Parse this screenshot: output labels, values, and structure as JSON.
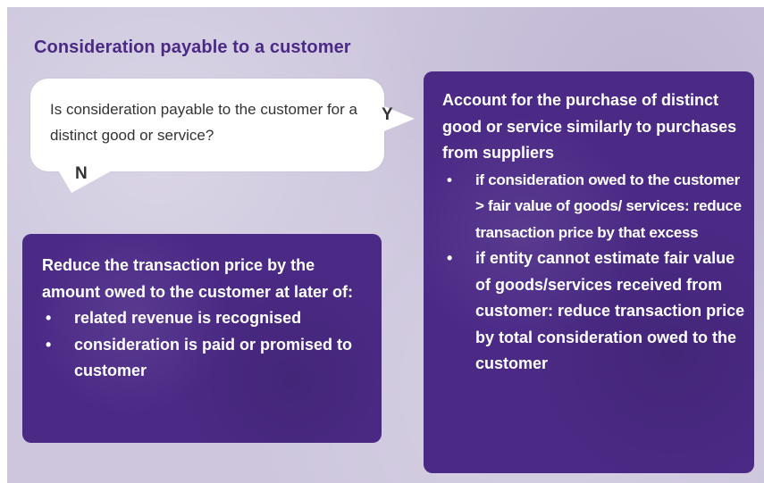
{
  "title": "Consideration payable to a customer",
  "question": "Is consideration payable to the customer for a distinct good or service?",
  "yes_label": "Y",
  "no_label": "N",
  "no_box": {
    "heading": "Reduce the transaction price by the amount owed to the customer at later of:",
    "bullets": [
      "related revenue is recognised",
      "consideration is paid or promised to customer"
    ]
  },
  "yes_box": {
    "heading": "Account for the purchase of distinct good or service similarly to purchases from suppliers",
    "bullets": [
      "if consideration owed to the customer > fair value of goods/ services: reduce transaction price by that excess",
      "if entity cannot estimate fair value of goods/services received from customer: reduce transaction price by total consideration owed to the customer"
    ]
  },
  "colors": {
    "accent": "#4b2a86",
    "background": "#cdc6dd",
    "question_bg": "#ffffff"
  }
}
